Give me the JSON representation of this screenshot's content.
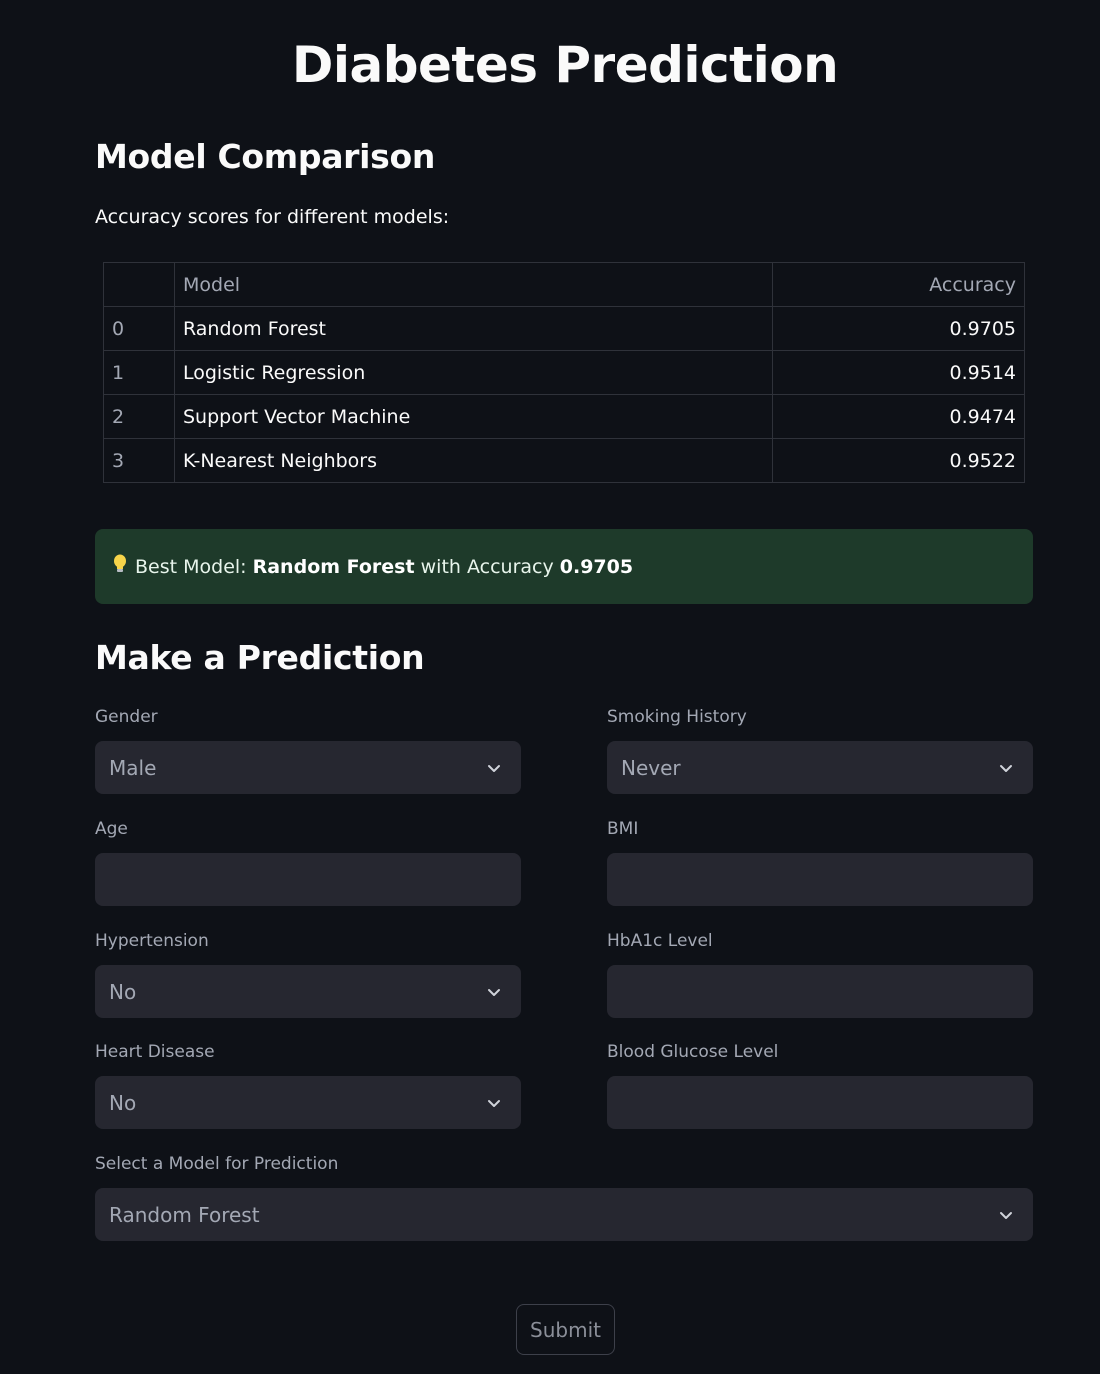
{
  "page": {
    "title": "Diabetes Prediction"
  },
  "comparison": {
    "heading": "Model Comparison",
    "caption": "Accuracy scores for different models:",
    "columns": {
      "index": "",
      "model": "Model",
      "accuracy": "Accuracy"
    },
    "rows": [
      {
        "index": "0",
        "model": "Random Forest",
        "accuracy": "0.9705"
      },
      {
        "index": "1",
        "model": "Logistic Regression",
        "accuracy": "0.9514"
      },
      {
        "index": "2",
        "model": "Support Vector Machine",
        "accuracy": "0.9474"
      },
      {
        "index": "3",
        "model": "K-Nearest Neighbors",
        "accuracy": "0.9522"
      }
    ]
  },
  "best": {
    "icon": "lightbulb-icon",
    "prefix": "Best Model: ",
    "model": "Random Forest",
    "middle": " with Accuracy ",
    "accuracy": "0.9705",
    "background_color": "#1e3a2a"
  },
  "prediction": {
    "heading": "Make a Prediction",
    "gender": {
      "label": "Gender",
      "value": "Male"
    },
    "smoking": {
      "label": "Smoking History",
      "value": "Never"
    },
    "age": {
      "label": "Age",
      "value": ""
    },
    "bmi": {
      "label": "BMI",
      "value": ""
    },
    "hypertension": {
      "label": "Hypertension",
      "value": "No"
    },
    "hba1c": {
      "label": "HbA1c Level",
      "value": ""
    },
    "heart": {
      "label": "Heart Disease",
      "value": "No"
    },
    "glucose": {
      "label": "Blood Glucose Level",
      "value": ""
    },
    "model_select": {
      "label": "Select a Model for Prediction",
      "value": "Random Forest"
    },
    "submit_label": "Submit"
  },
  "theme": {
    "background": "#0e1117",
    "input_background": "#262730",
    "text": "#fafafa",
    "muted_text": "#a3a8b4"
  }
}
